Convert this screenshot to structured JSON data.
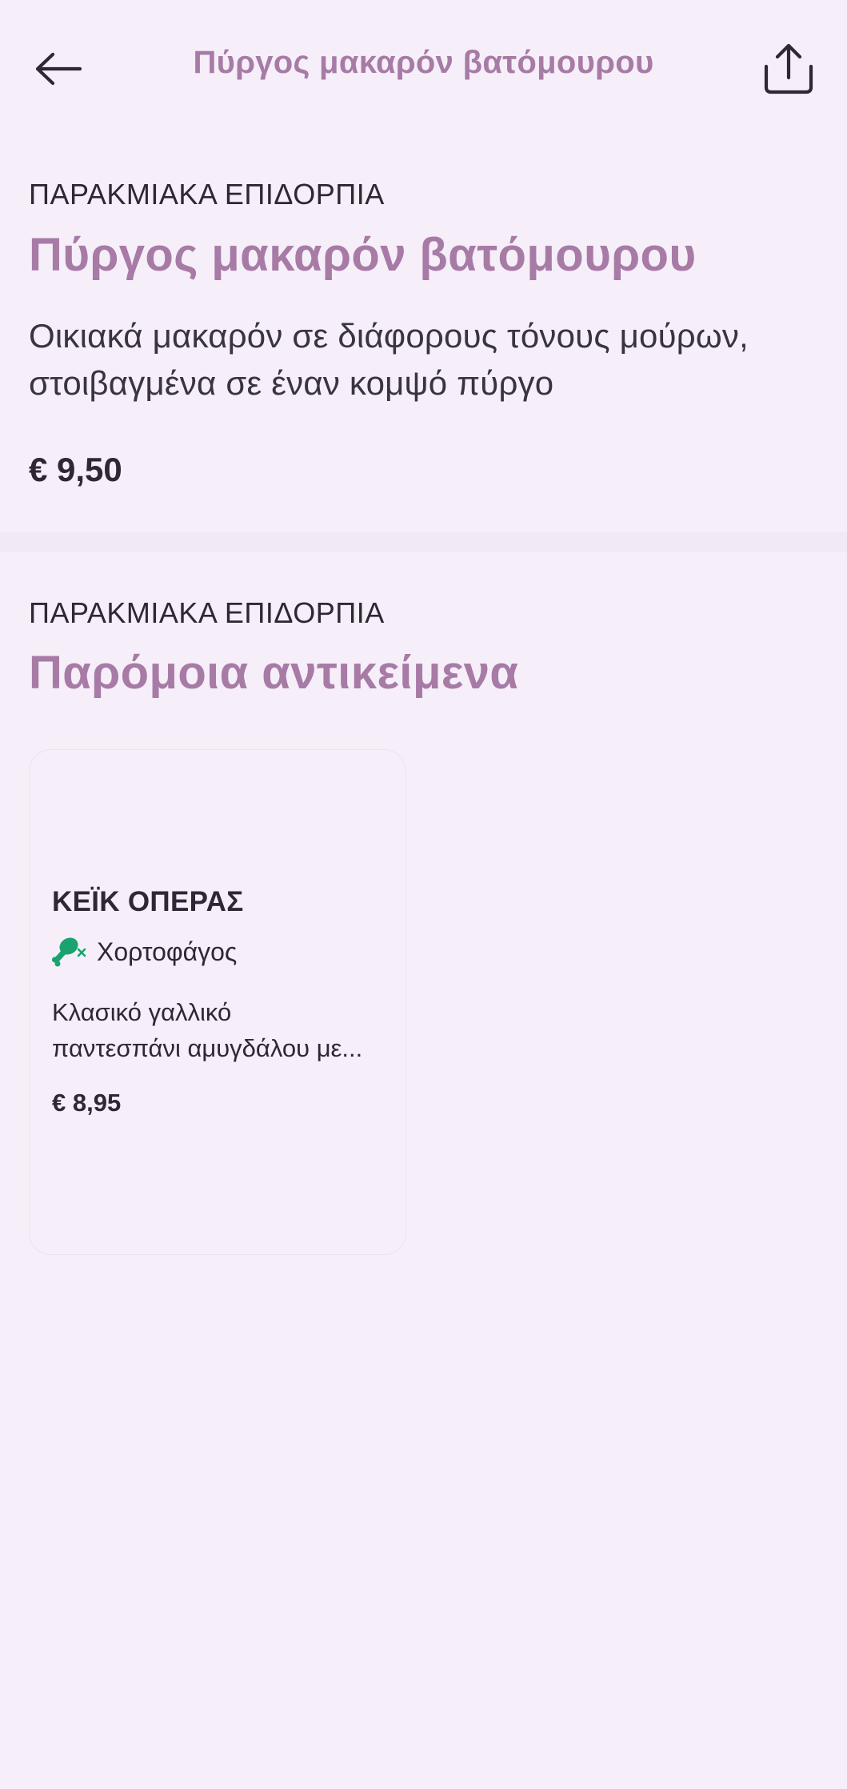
{
  "header": {
    "title": "Πύργος μακαρόν βατόμουρου",
    "back_icon": "arrow-left-icon",
    "share_icon": "share-icon"
  },
  "item": {
    "category": "ΠΑΡΑΚΜΙΑΚΑ ΕΠΙΔΟΡΠΙΑ",
    "title": "Πύργος μακαρόν βατόμουρου",
    "description_line1": "Οικιακά μακαρόν σε διάφορους τόνους μούρων,",
    "description_line2": "στοιβαγμένα σε έναν κομψό πύργο",
    "price": "€ 9,50"
  },
  "similar": {
    "category": "ΠΑΡΑΚΜΙΑΚΑ ΕΠΙΔΟΡΠΙΑ",
    "title": "Παρόμοια αντικείμενα",
    "items": [
      {
        "name": "ΚΕΪΚ ΟΠΕΡΑΣ",
        "diet_label": "Χορτοφάγος",
        "diet_icon": "drumstick-crossed-icon",
        "description_line1": "Κλασικό γαλλικό",
        "description_line2": "παντεσπάνι αμυγδάλου με...",
        "price": "€ 8,95"
      }
    ]
  },
  "colors": {
    "background": "#f6eff9",
    "accent": "#a77ba6",
    "text": "#2f2734",
    "diet_green": "#1aa36f"
  }
}
